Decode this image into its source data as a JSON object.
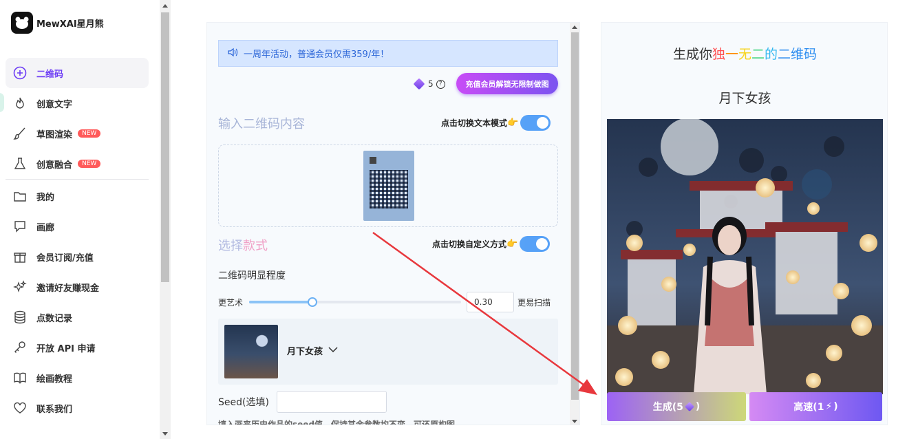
{
  "brand": {
    "name": "MewXAI星月熊"
  },
  "sidebar": {
    "items": [
      {
        "label": "二维码",
        "icon": "plus-circle-icon",
        "active": true
      },
      {
        "label": "创意文字",
        "icon": "flame-icon"
      },
      {
        "label": "草图渲染",
        "icon": "brush-icon",
        "badge": "NEW"
      },
      {
        "label": "创意融合",
        "icon": "flask-icon",
        "badge": "NEW"
      },
      {
        "label": "我的",
        "icon": "folder-icon"
      },
      {
        "label": "画廊",
        "icon": "chat-icon"
      },
      {
        "label": "会员订阅/充值",
        "icon": "gift-icon"
      },
      {
        "label": "邀请好友赚现金",
        "icon": "sparkle-icon"
      },
      {
        "label": "点数记录",
        "icon": "database-icon"
      },
      {
        "label": "开放 API 申请",
        "icon": "key-icon"
      },
      {
        "label": "绘画教程",
        "icon": "book-icon"
      },
      {
        "label": "联系我们",
        "icon": "heart-icon"
      }
    ]
  },
  "form": {
    "notice": "一周年活动，普通会员仅需359/年！",
    "points": "5",
    "vip_button": "充值会员解锁无限制做图",
    "input_title": "输入二维码内容",
    "toggle_text_label": "点击切换文本模式",
    "style_title_a": "选择",
    "style_title_b": "款式",
    "toggle_custom_label": "点击切换自定义方式",
    "clarity_label": "二维码明显程度",
    "slider_left": "更艺术",
    "slider_right": "更易扫描",
    "slider_value": "0.30",
    "style_name": "月下女孩",
    "seed_label": "Seed(选填)",
    "seed_value": "",
    "seed_hint": "填入画来历史作品的seed值，保持其余参数均不变，可还原构图"
  },
  "slider": {
    "value": 0.3
  },
  "result": {
    "title_prefix": "生成你",
    "title_chars": [
      "独",
      "一",
      "无",
      "二",
      "的",
      "二维码"
    ],
    "subtitle": "月下女孩",
    "generate_label": "生成(5",
    "generate_suffix": ")",
    "fast_label": "高速(1",
    "fast_suffix": ")"
  }
}
